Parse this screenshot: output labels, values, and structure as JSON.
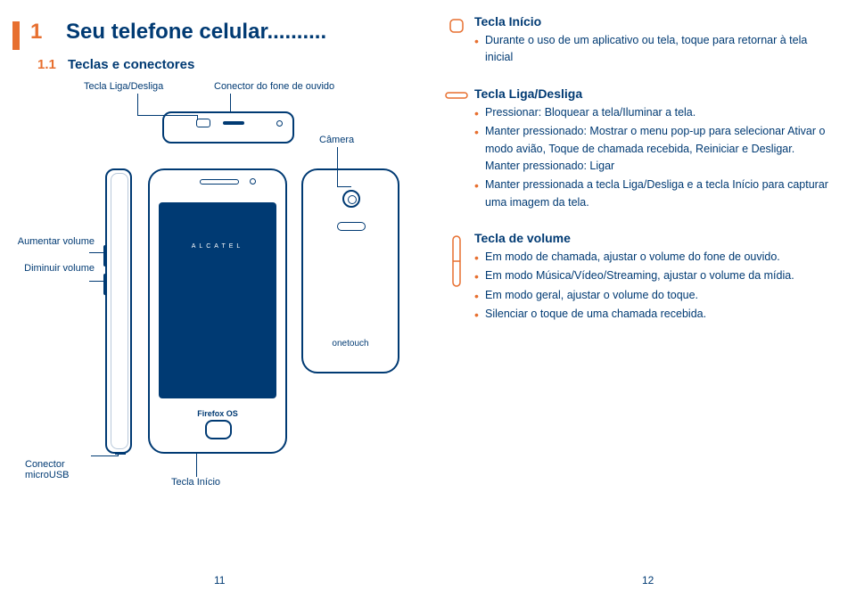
{
  "chapter": {
    "number": "1",
    "title": "Seu telefone celular.........."
  },
  "section": {
    "number": "1.1",
    "title": "Teclas e conectores"
  },
  "diagram": {
    "labels": {
      "power_key": "Tecla Liga/Desliga",
      "headset_connector": "Conector do fone de ouvido",
      "camera": "Câmera",
      "volume_up": "Aumentar volume",
      "volume_down": "Diminuir volume",
      "micro_usb": "Conector microUSB",
      "home_key": "Tecla Início"
    },
    "brand": "ALCATEL",
    "onetouch": "onetouch",
    "firefox": "Firefox OS"
  },
  "keys": {
    "home": {
      "title": "Tecla Início",
      "bullets": [
        "Durante o uso de um aplicativo ou tela, toque para retornar à tela inicial"
      ]
    },
    "power": {
      "title": "Tecla Liga/Desliga",
      "bullets": [
        "Pressionar: Bloquear a tela/Iluminar a tela.",
        "Manter pressionado: Mostrar o menu pop-up para selecionar Ativar o modo avião, Toque de chamada recebida, Reiniciar e Desligar.\nManter pressionado: Ligar",
        "Manter pressionada a tecla Liga/Desliga e a tecla Início para capturar uma imagem da tela."
      ]
    },
    "volume": {
      "title": "Tecla de volume",
      "bullets": [
        "Em modo de chamada, ajustar o volume do fone de ouvido.",
        "Em modo Música/Vídeo/Streaming, ajustar o volume da mídia.",
        "Em modo geral, ajustar o volume do toque.",
        "Silenciar o toque de uma chamada recebida."
      ]
    }
  },
  "pagenums": {
    "left": "11",
    "right": "12"
  }
}
